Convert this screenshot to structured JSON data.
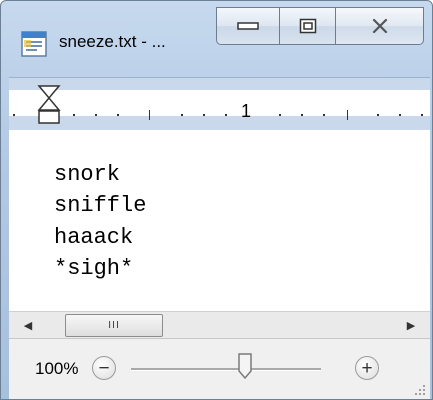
{
  "window": {
    "title": "sneeze.txt - ...",
    "app_icon": "wordpad-document-icon"
  },
  "caption_buttons": {
    "minimize_icon": "minimize-icon",
    "maximize_icon": "maximize-icon",
    "close_icon": "close-icon"
  },
  "ruler": {
    "number": "1"
  },
  "document": {
    "lines": [
      "snork",
      "sniffle",
      "haaack",
      "*sigh*"
    ]
  },
  "scrollbar": {
    "thumb_grip": "III"
  },
  "zoom": {
    "level": "100%",
    "zoom_out_symbol": "−",
    "zoom_in_symbol": "+"
  },
  "colors": {
    "frame": "#b2c9e4",
    "ruler_band": "#c9d8ea",
    "status_bar": "#f0f0f0"
  }
}
